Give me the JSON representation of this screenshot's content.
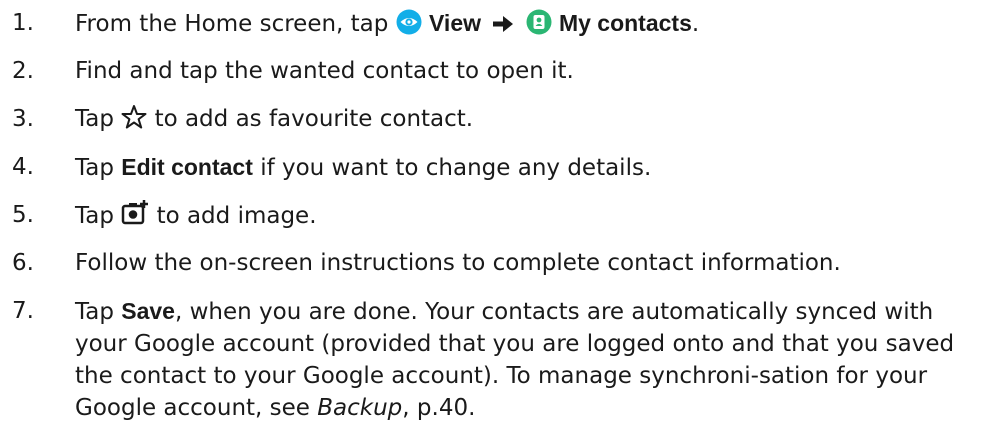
{
  "steps": [
    {
      "number": "1.",
      "pre": "From the Home screen, tap",
      "view_label": "View",
      "my_contacts_label": "My contacts",
      "end": ".",
      "icons": [
        "eye-icon",
        "arrow-right-icon",
        "contact-card-icon"
      ],
      "icon_colors": {
        "eye": "#12aee8",
        "contacts": "#2bb673"
      }
    },
    {
      "number": "2.",
      "text": "Find and tap the wanted contact to open it."
    },
    {
      "number": "3.",
      "pre": "Tap",
      "post": "to add as favourite contact.",
      "icon": "star-outline-icon"
    },
    {
      "number": "4.",
      "pre": "Tap",
      "bold": "Edit contact",
      "post": "if you want to change any details."
    },
    {
      "number": "5.",
      "pre": "Tap",
      "post": "to add image.",
      "icon": "add-photo-icon"
    },
    {
      "number": "6.",
      "text": "Follow the on-screen instructions to complete contact information."
    },
    {
      "number": "7.",
      "pre": "Tap",
      "bold": "Save",
      "post": ", when you are done. Your contacts are automatically synced with your Google account (provided that you are logged onto and that you saved the contact to your Google account). To manage synchroni-sation for your Google account, see",
      "italic": "Backup",
      "end": ", p.40."
    }
  ]
}
